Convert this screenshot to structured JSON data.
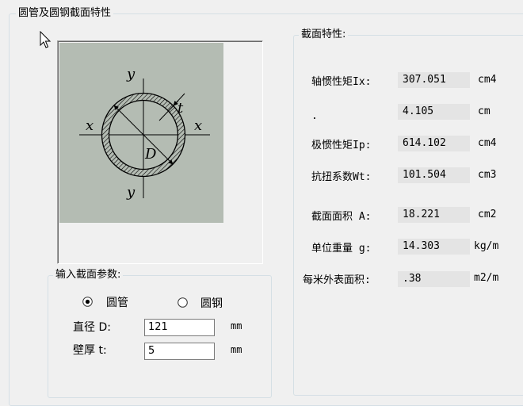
{
  "window": {
    "group_title": "圆管及圆钢截面特性"
  },
  "figure": {
    "labels": {
      "y_top": "y",
      "y_bottom": "y",
      "x_left": "x",
      "x_right": "x",
      "t": "t",
      "D": "D"
    }
  },
  "section": {
    "title": "截面特性:",
    "rows": [
      {
        "label": "轴惯性矩Ix:",
        "value": "307.051",
        "unit": "cm4"
      },
      {
        "label": ".",
        "value": "4.105",
        "unit": "cm"
      },
      {
        "label": "极惯性矩Ip:",
        "value": "614.102",
        "unit": "cm4"
      },
      {
        "label": "抗扭系数Wt:",
        "value": "101.504",
        "unit": "cm3"
      },
      {
        "label": "截面面积 A:",
        "value": "18.221",
        "unit": "cm2"
      },
      {
        "label": "单位重量 g:",
        "value": "14.303",
        "unit": "kg/m"
      },
      {
        "label": "每米外表面积:",
        "value": ".38",
        "unit": "m2/m"
      }
    ]
  },
  "input": {
    "title": "输入截面参数:",
    "options": [
      {
        "label": "圆管",
        "selected": true
      },
      {
        "label": "圆钢",
        "selected": false
      }
    ],
    "diameter": {
      "label": "直径 D:",
      "value": "121",
      "unit": "mm"
    },
    "thickness": {
      "label": "壁厚 t:",
      "value": "5",
      "unit": "mm"
    }
  },
  "colors": {
    "canvas": "#b4bcb3",
    "groupbox_border": "#d5dfe5",
    "readonly_field": "#e4e4e4"
  }
}
